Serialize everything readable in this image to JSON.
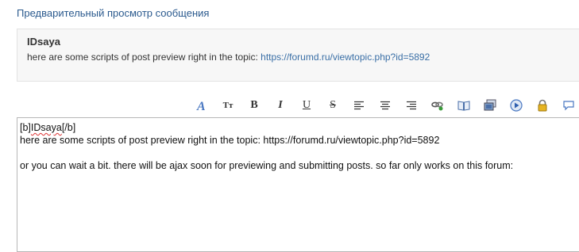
{
  "preview": {
    "title": "Предварительный просмотр сообщения",
    "author": "IDsaya",
    "text": "here are some scripts of post preview right in the topic: ",
    "link": "https://forumd.ru/viewtopic.php?id=5892"
  },
  "toolbar": {
    "italic_label": "I",
    "bold_label": "B",
    "underline_label": "U",
    "strike_label": "S",
    "size_label": "Tт",
    "icons": [
      "font-color-icon",
      "font-size-icon",
      "bold-icon",
      "italic-icon",
      "underline-icon",
      "strikethrough-icon",
      "align-left-icon",
      "align-center-icon",
      "align-right-icon",
      "link-icon",
      "book-icon",
      "images-icon",
      "play-icon",
      "lock-icon",
      "speech-bubble-icon"
    ]
  },
  "editor": {
    "line1_open": "[b]",
    "line1_name": "IDsaya",
    "line1_close": "[/b]",
    "line2": "here are some scripts of post preview right in the topic: https://forumd.ru/viewtopic.php?id=5892",
    "line3": "",
    "line4": "or you can wait a bit. there will be ajax soon for previewing and submitting posts. so far only works on this forum:"
  },
  "colors": {
    "link": "#3a6fa6",
    "title": "#2b5a8e",
    "accent": "#4a78c2"
  }
}
